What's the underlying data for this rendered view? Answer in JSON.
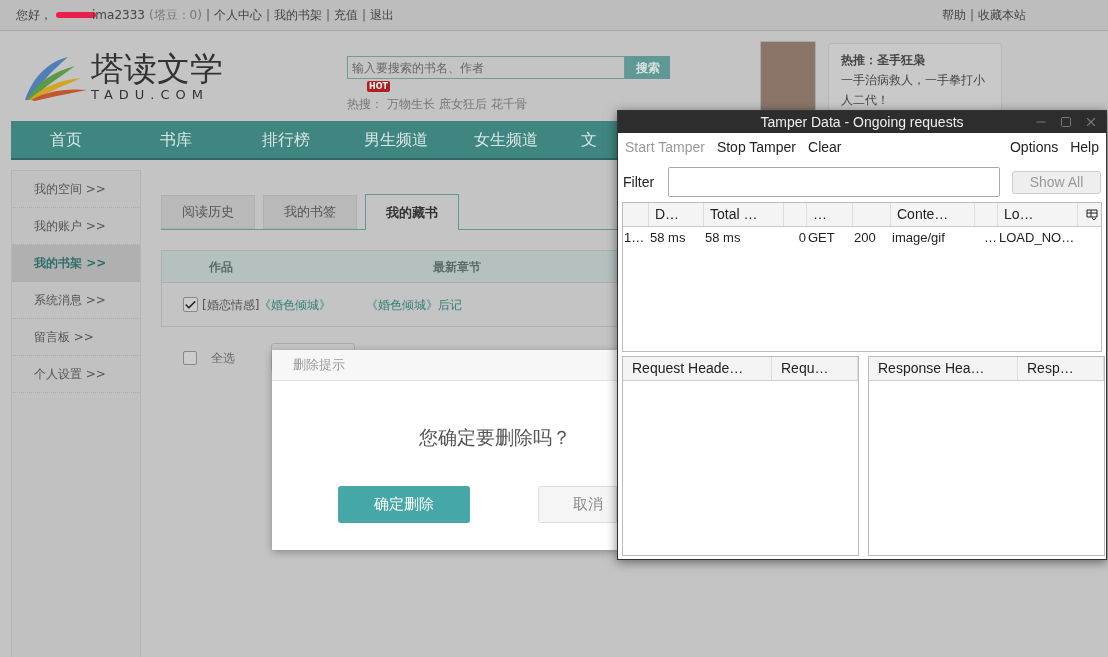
{
  "top_bar": {
    "left": [
      {
        "kind": "text",
        "text": "您好，"
      },
      {
        "kind": "redacted",
        "text": "ima2333"
      },
      {
        "kind": "muted",
        "text": "(塔豆：0)"
      },
      {
        "kind": "separator",
        "text": "|"
      },
      {
        "kind": "link",
        "text": "个人中心"
      },
      {
        "kind": "separator",
        "text": "|"
      },
      {
        "kind": "link",
        "text": "我的书架"
      },
      {
        "kind": "separator",
        "text": "|"
      },
      {
        "kind": "link",
        "text": "充值"
      },
      {
        "kind": "separator",
        "text": "|"
      },
      {
        "kind": "link",
        "text": "退出"
      }
    ],
    "right": [
      {
        "kind": "link",
        "text": "帮助"
      },
      {
        "kind": "separator",
        "text": "|"
      },
      {
        "kind": "link",
        "text": "收藏本站"
      }
    ]
  },
  "header": {
    "logo": {
      "name": "塔读文学",
      "domain": "TADU.COM"
    },
    "search": {
      "placeholder": "输入要搜索的书名、作者",
      "button": "搜索"
    },
    "hot": {
      "badge": "HOT",
      "label": "热搜：",
      "terms": [
        "万物生长",
        "庶女狂后",
        "花千骨"
      ]
    },
    "promo": {
      "title": "热推：圣手狂枭",
      "text": "一手治病救人，一手拳打小人二代！"
    }
  },
  "nav": [
    "首页",
    "书库",
    "排行榜",
    "男生频道",
    "女生频道",
    "文"
  ],
  "sidebar": [
    {
      "label": "我的空间 >>",
      "selected": false
    },
    {
      "label": "我的账户 >>",
      "selected": false
    },
    {
      "label": "我的书架 >>",
      "selected": true
    },
    {
      "label": "系统消息 >>",
      "selected": false
    },
    {
      "label": "留言板 >>",
      "selected": false
    },
    {
      "label": "个人设置 >>",
      "selected": false
    }
  ],
  "tabs": [
    {
      "label": "阅读历史",
      "selected": false
    },
    {
      "label": "我的书签",
      "selected": false
    },
    {
      "label": "我的藏书",
      "selected": true
    }
  ],
  "table": {
    "columns": [
      "作品",
      "最新章节"
    ],
    "rows": [
      {
        "checked": true,
        "genre": "[婚恋情感]",
        "title": "《婚色倾城》",
        "latest": "《婚色倾城》后记"
      }
    ]
  },
  "select_all": {
    "label": "全选",
    "checked": false
  },
  "dialog": {
    "title": "删除提示",
    "message": "您确定要删除吗？",
    "confirm": "确定删除",
    "cancel": "取消"
  },
  "tamper": {
    "title": "Tamper Data - Ongoing requests",
    "menu": [
      {
        "label": "Start Tamper",
        "disabled": true
      },
      {
        "label": "Stop Tamper",
        "disabled": false
      },
      {
        "label": "Clear",
        "disabled": false
      }
    ],
    "menu_right": [
      "Options",
      "Help"
    ],
    "filter_label": "Filter",
    "show_all": {
      "label": "Show All",
      "disabled": true
    },
    "columns": [
      {},
      {
        "label": "D…"
      },
      {
        "label": "Total …"
      },
      {},
      {
        "label": "…"
      },
      {},
      {
        "label": "Conte…"
      },
      {},
      {
        "label": "Lo…"
      }
    ],
    "rows": [
      [
        "1…",
        "58 ms",
        "58 ms",
        "0",
        "GET",
        "200",
        "image/gif",
        "…",
        "LOAD_NO…"
      ]
    ],
    "request_columns": [
      "Request Heade…",
      "Requ…"
    ],
    "response_columns": [
      "Response Hea…",
      "Resp…"
    ]
  }
}
